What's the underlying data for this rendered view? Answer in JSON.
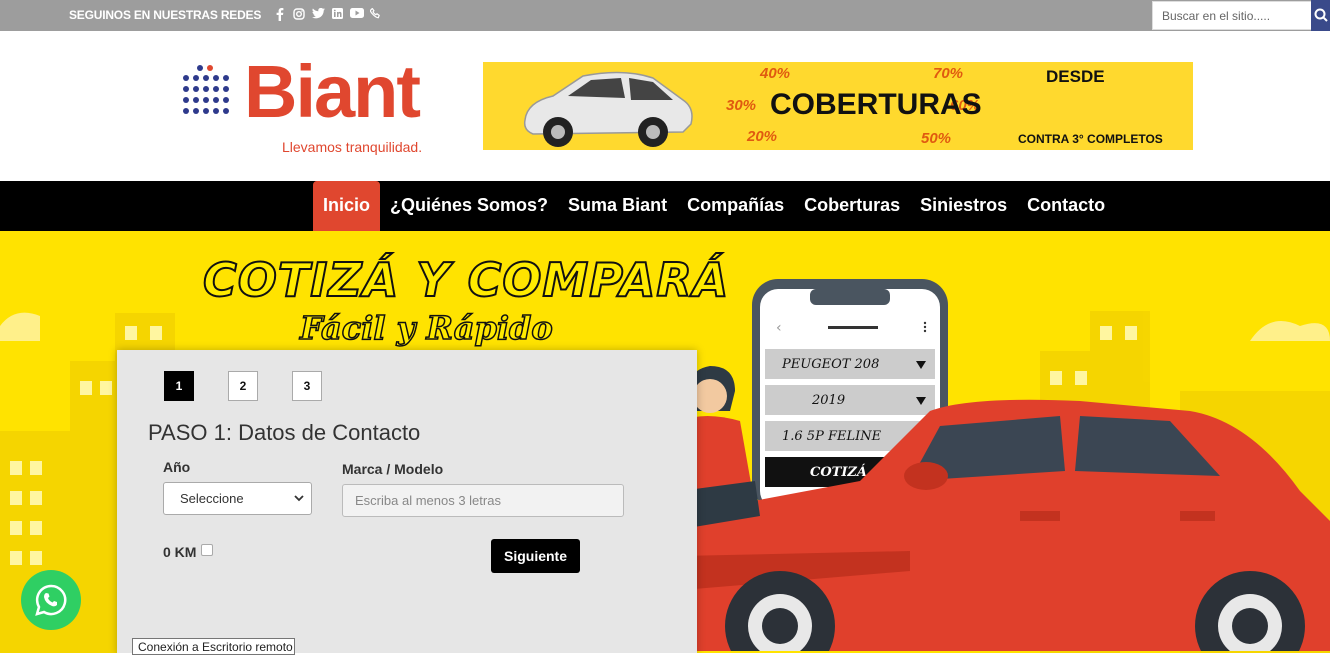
{
  "topbar": {
    "social_label": "SEGUINOS EN NUESTRAS REDES",
    "icons": [
      "facebook-icon",
      "instagram-icon",
      "twitter-icon",
      "linkedin-icon",
      "youtube-icon",
      "phone-icon"
    ],
    "search_placeholder": "Buscar en el sitio....."
  },
  "header": {
    "brand": "Biant",
    "tagline": "Llevamos tranquilidad.",
    "banner": {
      "headline": "COBERTURAS",
      "percents": [
        "40%",
        "70%",
        "30%",
        "60%",
        "20%",
        "50%"
      ],
      "desde": "DESDE",
      "contra": "CONTRA 3° COMPLETOS"
    }
  },
  "nav": {
    "items": [
      {
        "label": "Inicio",
        "active": true
      },
      {
        "label": "¿Quiénes Somos?"
      },
      {
        "label": "Suma Biant"
      },
      {
        "label": "Compañías"
      },
      {
        "label": "Coberturas"
      },
      {
        "label": "Siniestros"
      },
      {
        "label": "Contacto"
      }
    ]
  },
  "hero": {
    "title": "COTIZÁ Y COMPARÁ",
    "subtitle": "Fácil y Rápido",
    "phone_rows": [
      "PEUGEOT 208",
      "2019",
      "1.6 5P FELINE"
    ],
    "phone_button": "COTIZÁ"
  },
  "form": {
    "steps": [
      "1",
      "2",
      "3"
    ],
    "active_step": "1",
    "heading": "PASO 1: Datos de Contacto",
    "year_label": "Año",
    "year_value": "Seleccione",
    "model_label": "Marca / Modelo",
    "model_placeholder": "Escriba al menos 3 letras",
    "km_label": "0 KM",
    "km_checked": false,
    "next_button": "Siguiente"
  },
  "tooltip": "Conexión a Escritorio remoto",
  "colors": {
    "brand_red": "#e0472f",
    "hero_yellow": "#ffe300",
    "nav_black": "#000000",
    "whatsapp_green": "#2fcf63"
  }
}
